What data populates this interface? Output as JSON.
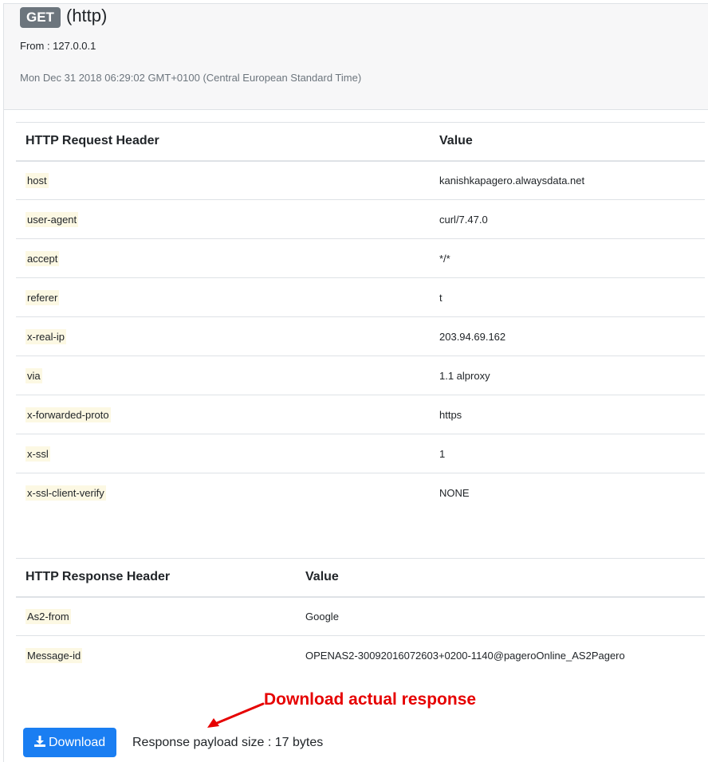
{
  "request": {
    "method": "GET",
    "protocol": "(http)",
    "from": "From : 127.0.0.1",
    "date": "Mon Dec 31 2018 06:29:02 GMT+0100 (Central European Standard Time)"
  },
  "request_headers": {
    "col_header": "HTTP Request Header",
    "col_value": "Value",
    "rows": [
      {
        "key": "host",
        "value": "kanishkapagero.alwaysdata.net"
      },
      {
        "key": "user-agent",
        "value": "curl/7.47.0"
      },
      {
        "key": "accept",
        "value": "*/*"
      },
      {
        "key": "referer",
        "value": "t"
      },
      {
        "key": "x-real-ip",
        "value": "203.94.69.162"
      },
      {
        "key": "via",
        "value": "1.1 alproxy"
      },
      {
        "key": "x-forwarded-proto",
        "value": "https"
      },
      {
        "key": "x-ssl",
        "value": "1"
      },
      {
        "key": "x-ssl-client-verify",
        "value": "NONE"
      }
    ]
  },
  "response_headers": {
    "col_header": "HTTP Response Header",
    "col_value": "Value",
    "rows": [
      {
        "key": "As2-from",
        "value": "Google"
      },
      {
        "key": "Message-id",
        "value": "OPENAS2-30092016072603+0200-1140@pageroOnline_AS2Pagero"
      }
    ]
  },
  "annotation": "Download actual response",
  "download": {
    "label": "Download",
    "icon": "download-icon"
  },
  "payload_size": "Response payload size : 17 bytes",
  "colors": {
    "badge": "#6c757d",
    "button": "#1a7ef2",
    "annotation": "#e60000",
    "key_highlight": "#fcf8e3"
  }
}
